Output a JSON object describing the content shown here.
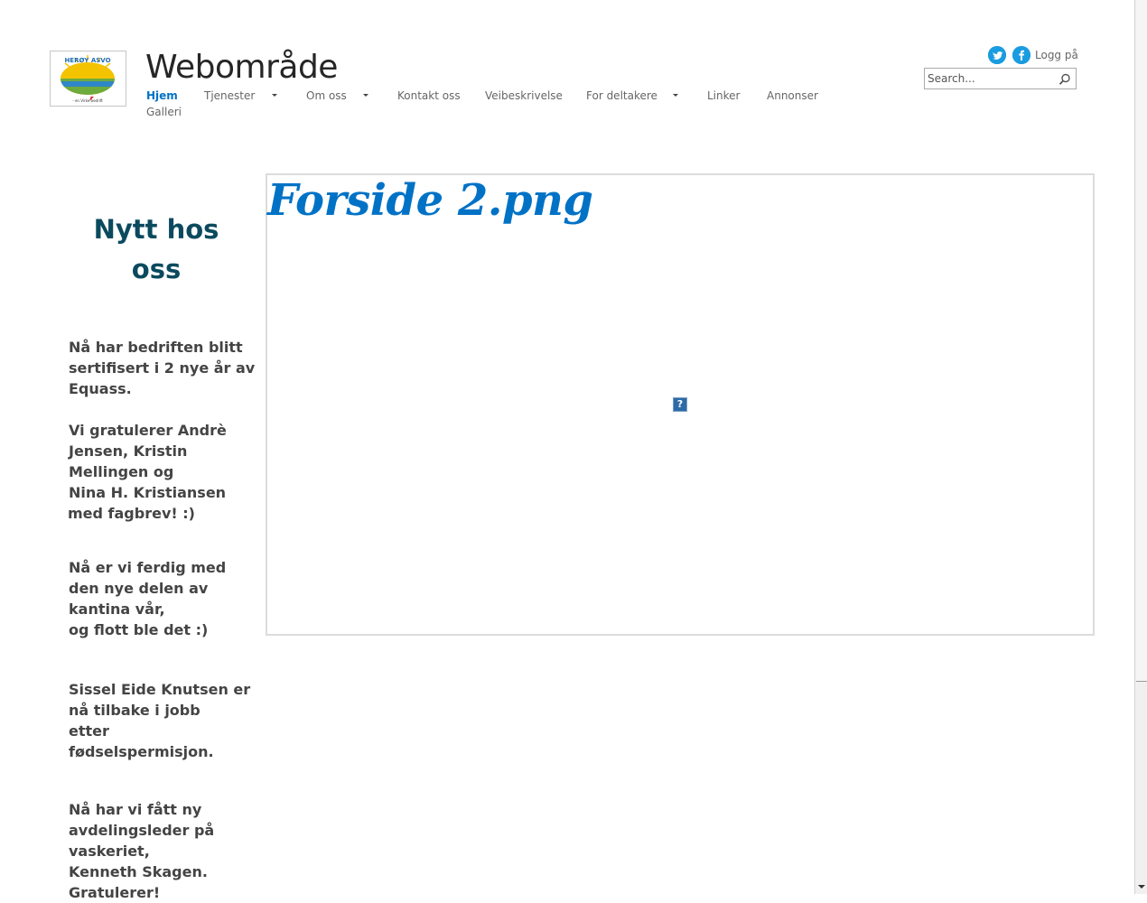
{
  "site": {
    "title": "Webområde",
    "logo": {
      "top_text": "HERØY ASVO",
      "bottom_text": "- en Virke bedrift"
    }
  },
  "nav": {
    "items": [
      {
        "label": "Hjem",
        "active": true,
        "has_dropdown": false
      },
      {
        "label": "Tjenester",
        "active": false,
        "has_dropdown": true
      },
      {
        "label": "Om oss",
        "active": false,
        "has_dropdown": true
      },
      {
        "label": "Kontakt oss",
        "active": false,
        "has_dropdown": false
      },
      {
        "label": "Veibeskrivelse",
        "active": false,
        "has_dropdown": false
      },
      {
        "label": "For deltakere",
        "active": false,
        "has_dropdown": true
      },
      {
        "label": "Linker",
        "active": false,
        "has_dropdown": false
      },
      {
        "label": "Annonser",
        "active": false,
        "has_dropdown": false
      },
      {
        "label": "Galleri",
        "active": false,
        "has_dropdown": false
      }
    ]
  },
  "header": {
    "twitter_icon": "twitter-icon",
    "facebook_icon": "facebook-icon",
    "login_label": "Logg på",
    "search": {
      "placeholder": "Search...",
      "value": "",
      "icon": "magnifier-icon"
    }
  },
  "sidebar": {
    "heading_line1": "Nytt hos",
    "heading_line2": "oss",
    "news": [
      {
        "lines": [
          "Nå har bedriften blitt",
          "sertifisert i 2 nye år av",
          "Equass."
        ]
      },
      {
        "lines": [
          "Vi gratulerer Andrè",
          "Jensen, Kristin",
          "Mellingen og",
          "Nina H. Kristiansen",
          "med fagbrev! :)"
        ]
      },
      {
        "lines": [
          "Nå er vi ferdig med",
          "den nye delen av",
          "kantina vår,",
          "og flott ble det :)"
        ]
      },
      {
        "lines": [
          "Sissel Eide Knutsen er",
          "nå tilbake i jobb",
          "etter",
          "fødselspermisjon."
        ]
      },
      {
        "lines": [
          "Nå har vi fått ny",
          "avdelingsleder på",
          "vaskeriet,",
          "Kenneth Skagen.",
          "Gratulerer!"
        ]
      }
    ]
  },
  "main": {
    "image_title": "Forside 2.png",
    "broken_image_glyph": "?"
  },
  "colors": {
    "accent": "#0072c6",
    "heading": "#0b4a5e",
    "social": "#1a9ce0"
  }
}
